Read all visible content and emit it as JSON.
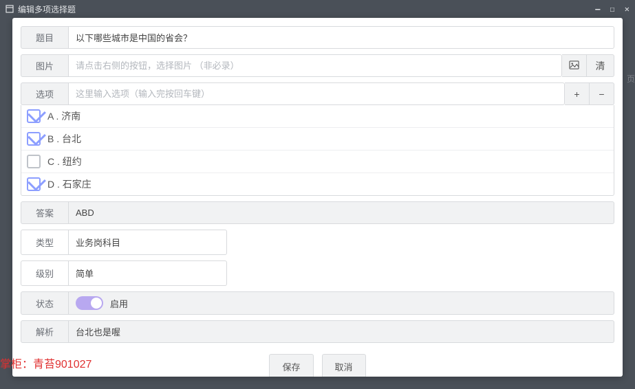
{
  "titlebar": {
    "title": "编辑多项选择题"
  },
  "fields": {
    "question_label": "题目",
    "question_value": "以下哪些城市是中国的省会？",
    "image_label": "图片",
    "image_placeholder": "请点击右侧的按钮，选择图片 （非必录）",
    "image_clear": "清",
    "option_label": "选项",
    "option_placeholder": "这里输入选项（输入完按回车键）",
    "answer_label": "答案",
    "answer_value": "ABD",
    "type_label": "类型",
    "type_value": "业务岗科目",
    "level_label": "级别",
    "level_value": "简单",
    "status_label": "状态",
    "status_value": "启用",
    "explain_label": "解析",
    "explain_value": "台北也是喔"
  },
  "options": [
    {
      "letter": "A",
      "text": "济南",
      "checked": true
    },
    {
      "letter": "B",
      "text": "台北",
      "checked": true
    },
    {
      "letter": "C",
      "text": "纽约",
      "checked": false
    },
    {
      "letter": "D",
      "text": "石家庄",
      "checked": true
    }
  ],
  "buttons": {
    "save": "保存",
    "cancel": "取消"
  },
  "watermark": "掌柜：青苔901027",
  "bg_hint": "页"
}
